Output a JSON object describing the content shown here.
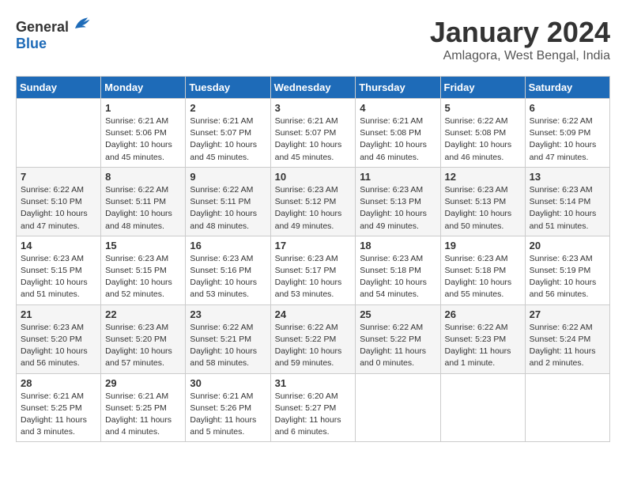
{
  "logo": {
    "general": "General",
    "blue": "Blue"
  },
  "header": {
    "month": "January 2024",
    "location": "Amlagora, West Bengal, India"
  },
  "days_of_week": [
    "Sunday",
    "Monday",
    "Tuesday",
    "Wednesday",
    "Thursday",
    "Friday",
    "Saturday"
  ],
  "weeks": [
    [
      {
        "day": "",
        "info": ""
      },
      {
        "day": "1",
        "info": "Sunrise: 6:21 AM\nSunset: 5:06 PM\nDaylight: 10 hours\nand 45 minutes."
      },
      {
        "day": "2",
        "info": "Sunrise: 6:21 AM\nSunset: 5:07 PM\nDaylight: 10 hours\nand 45 minutes."
      },
      {
        "day": "3",
        "info": "Sunrise: 6:21 AM\nSunset: 5:07 PM\nDaylight: 10 hours\nand 45 minutes."
      },
      {
        "day": "4",
        "info": "Sunrise: 6:21 AM\nSunset: 5:08 PM\nDaylight: 10 hours\nand 46 minutes."
      },
      {
        "day": "5",
        "info": "Sunrise: 6:22 AM\nSunset: 5:08 PM\nDaylight: 10 hours\nand 46 minutes."
      },
      {
        "day": "6",
        "info": "Sunrise: 6:22 AM\nSunset: 5:09 PM\nDaylight: 10 hours\nand 47 minutes."
      }
    ],
    [
      {
        "day": "7",
        "info": "Sunrise: 6:22 AM\nSunset: 5:10 PM\nDaylight: 10 hours\nand 47 minutes."
      },
      {
        "day": "8",
        "info": "Sunrise: 6:22 AM\nSunset: 5:11 PM\nDaylight: 10 hours\nand 48 minutes."
      },
      {
        "day": "9",
        "info": "Sunrise: 6:22 AM\nSunset: 5:11 PM\nDaylight: 10 hours\nand 48 minutes."
      },
      {
        "day": "10",
        "info": "Sunrise: 6:23 AM\nSunset: 5:12 PM\nDaylight: 10 hours\nand 49 minutes."
      },
      {
        "day": "11",
        "info": "Sunrise: 6:23 AM\nSunset: 5:13 PM\nDaylight: 10 hours\nand 49 minutes."
      },
      {
        "day": "12",
        "info": "Sunrise: 6:23 AM\nSunset: 5:13 PM\nDaylight: 10 hours\nand 50 minutes."
      },
      {
        "day": "13",
        "info": "Sunrise: 6:23 AM\nSunset: 5:14 PM\nDaylight: 10 hours\nand 51 minutes."
      }
    ],
    [
      {
        "day": "14",
        "info": "Sunrise: 6:23 AM\nSunset: 5:15 PM\nDaylight: 10 hours\nand 51 minutes."
      },
      {
        "day": "15",
        "info": "Sunrise: 6:23 AM\nSunset: 5:15 PM\nDaylight: 10 hours\nand 52 minutes."
      },
      {
        "day": "16",
        "info": "Sunrise: 6:23 AM\nSunset: 5:16 PM\nDaylight: 10 hours\nand 53 minutes."
      },
      {
        "day": "17",
        "info": "Sunrise: 6:23 AM\nSunset: 5:17 PM\nDaylight: 10 hours\nand 53 minutes."
      },
      {
        "day": "18",
        "info": "Sunrise: 6:23 AM\nSunset: 5:18 PM\nDaylight: 10 hours\nand 54 minutes."
      },
      {
        "day": "19",
        "info": "Sunrise: 6:23 AM\nSunset: 5:18 PM\nDaylight: 10 hours\nand 55 minutes."
      },
      {
        "day": "20",
        "info": "Sunrise: 6:23 AM\nSunset: 5:19 PM\nDaylight: 10 hours\nand 56 minutes."
      }
    ],
    [
      {
        "day": "21",
        "info": "Sunrise: 6:23 AM\nSunset: 5:20 PM\nDaylight: 10 hours\nand 56 minutes."
      },
      {
        "day": "22",
        "info": "Sunrise: 6:23 AM\nSunset: 5:20 PM\nDaylight: 10 hours\nand 57 minutes."
      },
      {
        "day": "23",
        "info": "Sunrise: 6:22 AM\nSunset: 5:21 PM\nDaylight: 10 hours\nand 58 minutes."
      },
      {
        "day": "24",
        "info": "Sunrise: 6:22 AM\nSunset: 5:22 PM\nDaylight: 10 hours\nand 59 minutes."
      },
      {
        "day": "25",
        "info": "Sunrise: 6:22 AM\nSunset: 5:22 PM\nDaylight: 11 hours\nand 0 minutes."
      },
      {
        "day": "26",
        "info": "Sunrise: 6:22 AM\nSunset: 5:23 PM\nDaylight: 11 hours\nand 1 minute."
      },
      {
        "day": "27",
        "info": "Sunrise: 6:22 AM\nSunset: 5:24 PM\nDaylight: 11 hours\nand 2 minutes."
      }
    ],
    [
      {
        "day": "28",
        "info": "Sunrise: 6:21 AM\nSunset: 5:25 PM\nDaylight: 11 hours\nand 3 minutes."
      },
      {
        "day": "29",
        "info": "Sunrise: 6:21 AM\nSunset: 5:25 PM\nDaylight: 11 hours\nand 4 minutes."
      },
      {
        "day": "30",
        "info": "Sunrise: 6:21 AM\nSunset: 5:26 PM\nDaylight: 11 hours\nand 5 minutes."
      },
      {
        "day": "31",
        "info": "Sunrise: 6:20 AM\nSunset: 5:27 PM\nDaylight: 11 hours\nand 6 minutes."
      },
      {
        "day": "",
        "info": ""
      },
      {
        "day": "",
        "info": ""
      },
      {
        "day": "",
        "info": ""
      }
    ]
  ]
}
